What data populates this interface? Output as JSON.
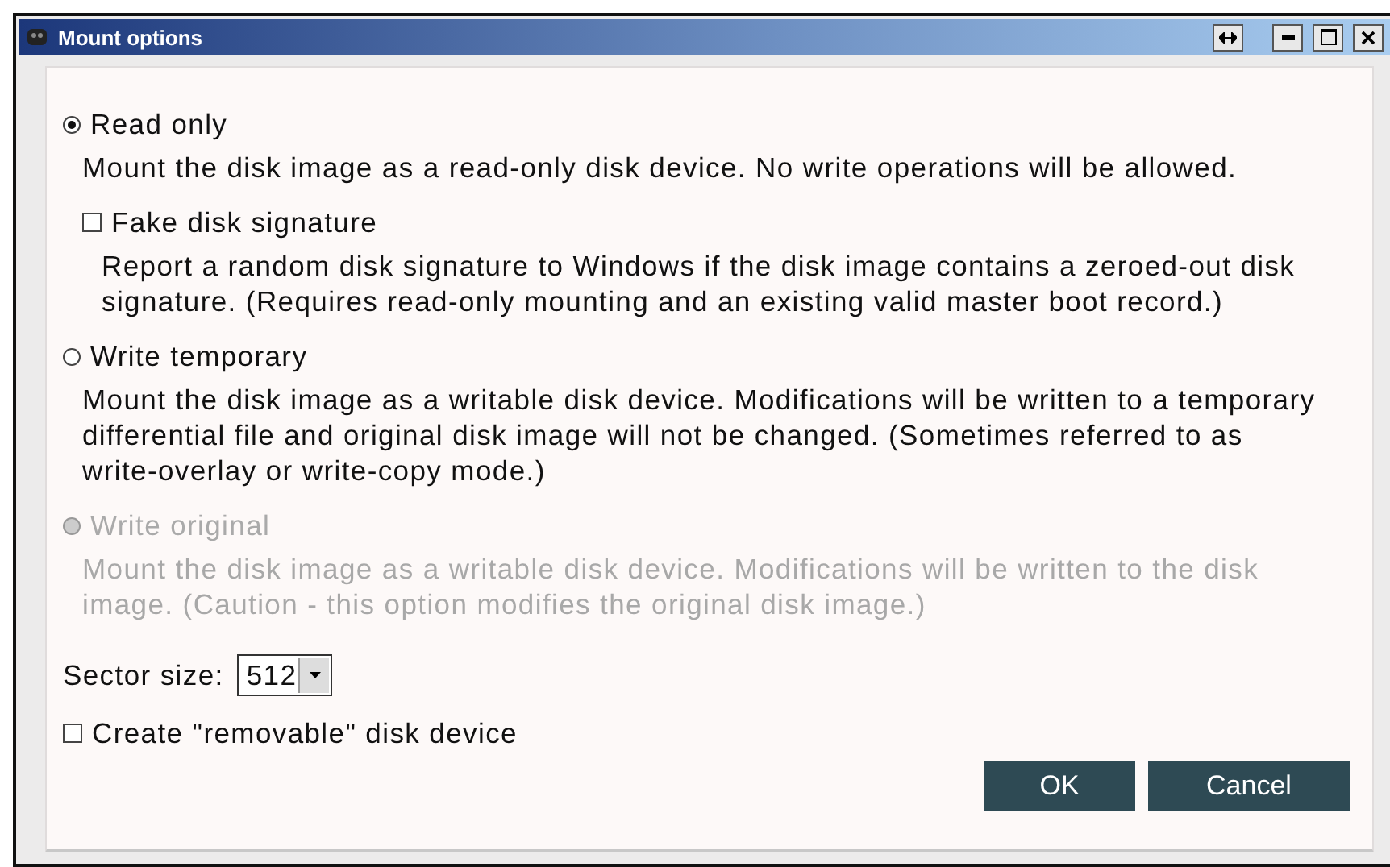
{
  "window": {
    "title": "Mount options"
  },
  "options": [
    {
      "kind": "radio",
      "label": "Read only",
      "selected": true,
      "disabled": false,
      "description": "Mount the disk image as a read-only disk device. No write operations will be allowed.",
      "children": [
        {
          "kind": "checkbox",
          "label": "Fake disk signature",
          "checked": false,
          "description": "Report a random disk signature to Windows if the disk image contains a zeroed-out disk signature. (Requires read-only mounting and an existing valid master boot record.)"
        }
      ]
    },
    {
      "kind": "radio",
      "label": "Write temporary",
      "selected": false,
      "disabled": false,
      "description": "Mount the disk image as a writable disk device. Modifications will be written to a temporary differential file and original disk image will not be changed. (Sometimes referred to as write-overlay or write-copy mode.)"
    },
    {
      "kind": "radio",
      "label": "Write original",
      "selected": false,
      "disabled": true,
      "description": "Mount the disk image as a writable disk device. Modifications will be written to the disk image. (Caution - this option modifies the original disk image.)"
    }
  ],
  "sector_size": {
    "label": "Sector size:",
    "value": "512"
  },
  "removable": {
    "label": "Create \"removable\" disk device",
    "checked": false
  },
  "buttons": [
    "OK",
    "Cancel"
  ]
}
